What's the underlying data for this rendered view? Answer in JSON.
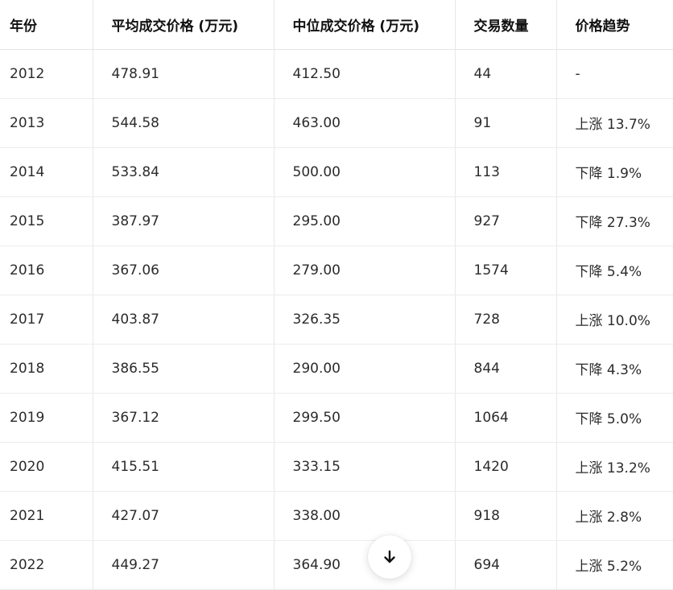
{
  "table": {
    "headers": [
      "年份",
      "平均成交价格 (万元)",
      "中位成交价格 (万元)",
      "交易数量",
      "价格趋势"
    ],
    "rows": [
      [
        "2012",
        "478.91",
        "412.50",
        "44",
        "-"
      ],
      [
        "2013",
        "544.58",
        "463.00",
        "91",
        "上涨 13.7%"
      ],
      [
        "2014",
        "533.84",
        "500.00",
        "113",
        "下降 1.9%"
      ],
      [
        "2015",
        "387.97",
        "295.00",
        "927",
        "下降 27.3%"
      ],
      [
        "2016",
        "367.06",
        "279.00",
        "1574",
        "下降 5.4%"
      ],
      [
        "2017",
        "403.87",
        "326.35",
        "728",
        "上涨 10.0%"
      ],
      [
        "2018",
        "386.55",
        "290.00",
        "844",
        "下降 4.3%"
      ],
      [
        "2019",
        "367.12",
        "299.50",
        "1064",
        "下降 5.0%"
      ],
      [
        "2020",
        "415.51",
        "333.15",
        "1420",
        "上涨 13.2%"
      ],
      [
        "2021",
        "427.07",
        "338.00",
        "918",
        "上涨 2.8%"
      ],
      [
        "2022",
        "449.27",
        "364.90",
        "694",
        "上涨 5.2%"
      ]
    ]
  },
  "scroll_button": {
    "icon": "arrow-down-icon"
  }
}
